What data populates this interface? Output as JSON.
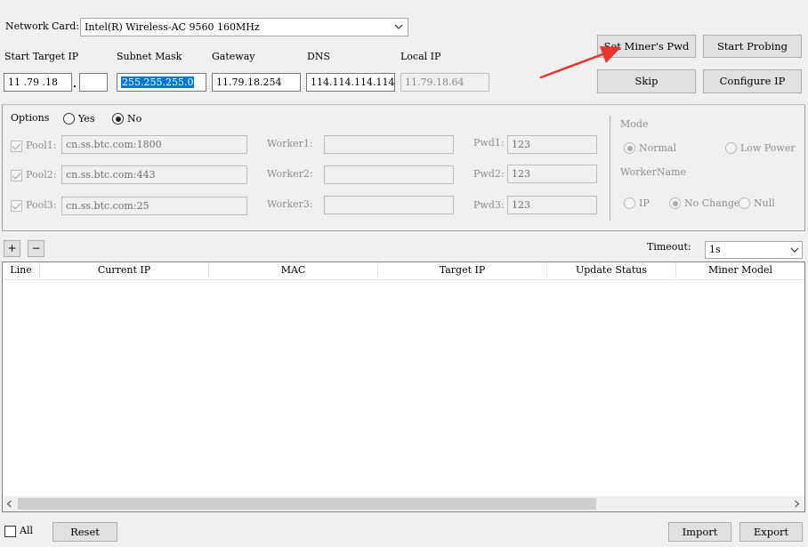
{
  "network": {
    "label": "Network Card:",
    "value": "Intel(R) Wireless-AC 9560 160MHz"
  },
  "ip": {
    "start_label": "Start Target IP",
    "start_value": "11 .79 .18",
    "start_last": "",
    "dot": ".",
    "subnet_label": "Subnet Mask",
    "subnet_value": "255.255.255.0",
    "gateway_label": "Gateway",
    "gateway_value": "11.79.18.254",
    "dns_label": "DNS",
    "dns_value": "114.114.114.114",
    "local_label": "Local IP",
    "local_value": "11.79.18.64"
  },
  "buttons": {
    "set_pwd": "Set Miner's Pwd",
    "start_probing": "Start Probing",
    "skip": "Skip",
    "configure_ip": "Configure IP",
    "plus": "+",
    "minus": "−",
    "reset": "Reset",
    "import": "Import",
    "export": "Export"
  },
  "options": {
    "label": "Options",
    "yes": "Yes",
    "no": "No",
    "selected": "No",
    "pools": [
      {
        "label": "Pool1:",
        "value": "cn.ss.btc.com:1800",
        "worker_label": "Worker1:",
        "worker_value": "",
        "pwd_label": "Pwd1:",
        "pwd_value": "123"
      },
      {
        "label": "Pool2:",
        "value": "cn.ss.btc.com:443",
        "worker_label": "Worker2:",
        "worker_value": "",
        "pwd_label": "Pwd2:",
        "pwd_value": "123"
      },
      {
        "label": "Pool3:",
        "value": "cn.ss.btc.com:25",
        "worker_label": "Worker3:",
        "worker_value": "",
        "pwd_label": "Pwd3:",
        "pwd_value": "123"
      }
    ]
  },
  "mode": {
    "label": "Mode",
    "normal": "Normal",
    "low_power": "Low Power",
    "selected": "Normal",
    "worker_name_label": "WorkerName",
    "ip": "IP",
    "no_change": "No Change",
    "null": "Null",
    "worker_selected": "No Change"
  },
  "timeout": {
    "label": "Timeout:",
    "value": "1s"
  },
  "table": {
    "columns": [
      "Line",
      "Current IP",
      "MAC",
      "Target IP",
      "Update Status",
      "Miner Model"
    ],
    "rows": []
  },
  "footer": {
    "all_label": "All"
  },
  "colors": {
    "selection": "#0078d7",
    "annotation_arrow": "#e8352b"
  }
}
